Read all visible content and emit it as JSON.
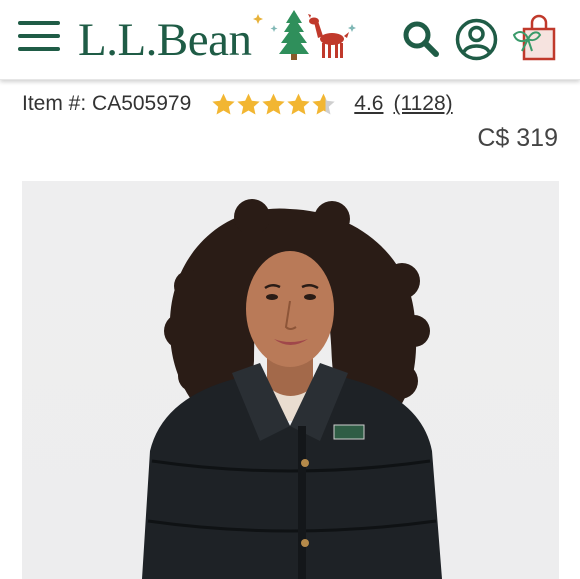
{
  "header": {
    "menu_icon": "hamburger-menu-icon",
    "logo_text": "L.L.Bean",
    "holiday_art": "tree-and-deer-icon",
    "search_icon": "search-icon",
    "account_icon": "account-icon",
    "cart_icon": "gift-bag-cart-icon",
    "brand_color": "#1f5c46",
    "accent_red": "#c0392b"
  },
  "product": {
    "item_number": "Item #: CA505979",
    "rating_value": "4.6",
    "review_count": "(1128)",
    "rating_stars": 4.6,
    "star_color": "#f2b632",
    "price": "C$ 319",
    "image_description_icon": "product-photo-woman-black-down-jacket"
  }
}
